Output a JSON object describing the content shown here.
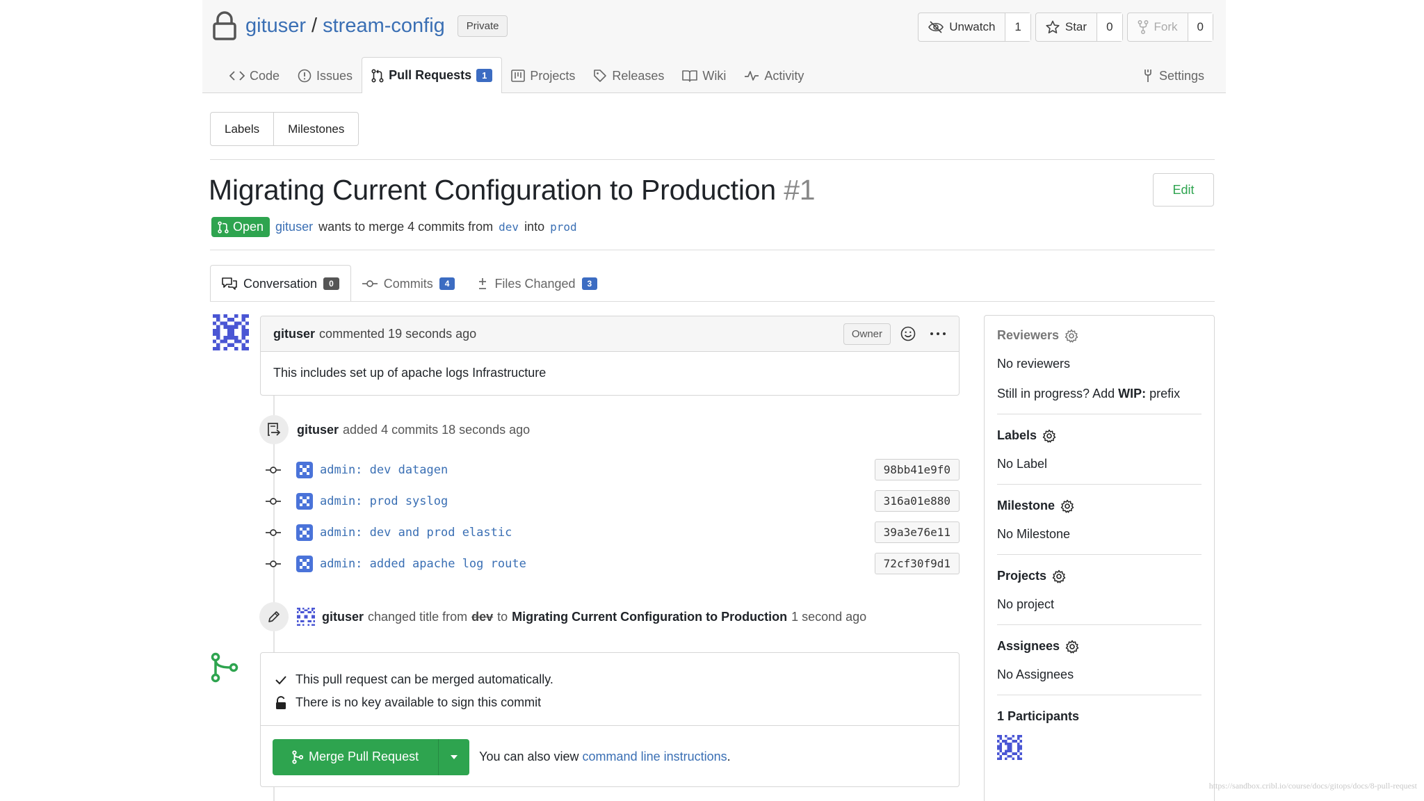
{
  "repo": {
    "owner": "gituser",
    "separator": "/",
    "name": "stream-config",
    "visibility": "Private"
  },
  "actions": {
    "unwatch_label": "Unwatch",
    "unwatch_count": "1",
    "star_label": "Star",
    "star_count": "0",
    "fork_label": "Fork",
    "fork_count": "0"
  },
  "nav": {
    "code": "Code",
    "issues": "Issues",
    "pull_requests": "Pull Requests",
    "pull_requests_count": "1",
    "projects": "Projects",
    "releases": "Releases",
    "wiki": "Wiki",
    "activity": "Activity",
    "settings": "Settings"
  },
  "subnav": {
    "labels": "Labels",
    "milestones": "Milestones"
  },
  "pr": {
    "title": "Migrating Current Configuration to Production",
    "number": "#1",
    "edit_label": "Edit",
    "state": "Open",
    "author": "gituser",
    "meta_text": "wants to merge 4 commits from",
    "head_branch": "dev",
    "into_text": "into",
    "base_branch": "prod"
  },
  "tabs": {
    "conversation": "Conversation",
    "conversation_count": "0",
    "commits": "Commits",
    "commits_count": "4",
    "files": "Files Changed",
    "files_count": "3"
  },
  "comment": {
    "author": "gituser",
    "action": "commented 19 seconds ago",
    "role": "Owner",
    "body": "This includes set up of apache logs Infrastructure"
  },
  "commits_event": {
    "author": "gituser",
    "text": "added 4 commits 18 seconds ago"
  },
  "commits": [
    {
      "message": "admin: dev datagen",
      "sha": "98bb41e9f0"
    },
    {
      "message": "admin: prod syslog",
      "sha": "316a01e880"
    },
    {
      "message": "admin: dev and prod elastic",
      "sha": "39a3e76e11"
    },
    {
      "message": "admin: added apache log route",
      "sha": "72cf30f9d1"
    }
  ],
  "title_event": {
    "author": "gituser",
    "text1": "changed title from",
    "old_title": "dev",
    "text2": "to",
    "new_title": "Migrating Current Configuration to Production",
    "time": "1 second ago"
  },
  "merge": {
    "status": "This pull request can be merged automatically.",
    "signing": "There is no key available to sign this commit",
    "button": "Merge Pull Request",
    "also_text": "You can also view",
    "link": "command line instructions",
    "period": "."
  },
  "sidebar": {
    "reviewers_head": "Reviewers",
    "reviewers_value": "No reviewers",
    "wip_text1": "Still in progress? Add",
    "wip_bold": "WIP:",
    "wip_text2": "prefix",
    "labels_head": "Labels",
    "labels_value": "No Label",
    "milestone_head": "Milestone",
    "milestone_value": "No Milestone",
    "projects_head": "Projects",
    "projects_value": "No project",
    "assignees_head": "Assignees",
    "assignees_value": "No Assignees",
    "participants_head": "1 Participants"
  },
  "watermark": "https://sandbox.cribl.io/course/docs/gitops/docs/8-pull-request",
  "colors": {
    "accent_green": "#2ea44f",
    "link_blue": "#3a6fb4",
    "badge_blue": "#3c6cc2",
    "avatar_purple": "#4a56d4"
  }
}
